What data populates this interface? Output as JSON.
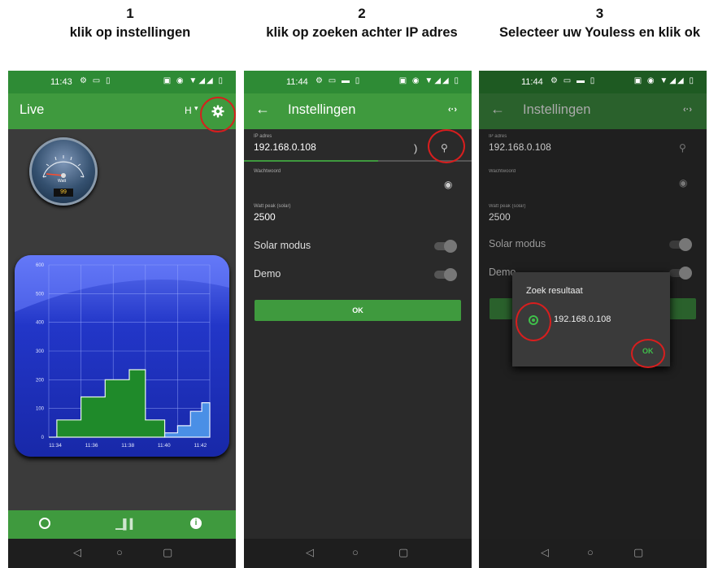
{
  "steps": [
    {
      "number": "1",
      "text": "klik op instellingen"
    },
    {
      "number": "2",
      "text": "klik op zoeken achter IP adres"
    },
    {
      "number": "3",
      "text": "Selecteer uw Youless en klik ok"
    }
  ],
  "phone1": {
    "time": "11:43",
    "title": "Live",
    "period": "H",
    "gauge": {
      "unit": "Watt",
      "value": "99",
      "scale": [
        "0",
        "500",
        "1000",
        "1500",
        "2000",
        "2500",
        "3000"
      ]
    },
    "nav_icons": [
      "gauge-icon",
      "bar-chart-icon",
      "info-icon"
    ]
  },
  "phone2": {
    "time": "11:44",
    "title": "Instellingen",
    "ip_label": "IP adres",
    "ip_value": "192.168.0.108",
    "password_label": "Wachtwoord",
    "watt_label": "Watt peak (solar)",
    "watt_value": "2500",
    "solar_label": "Solar modus",
    "demo_label": "Demo",
    "ok_label": "OK"
  },
  "phone3": {
    "time": "11:44",
    "title": "Instellingen",
    "ip_label": "IP adres",
    "ip_value": "192.168.0.108",
    "password_label": "Wachtwoord",
    "watt_label": "Watt peak (solar)",
    "watt_value": "2500",
    "solar_label": "Solar modus",
    "demo_label": "Demo",
    "dialog_title": "Zoek resultaat",
    "dialog_option": "192.168.0.108",
    "dialog_ok": "OK"
  },
  "colors": {
    "green": "#3f9a3e",
    "green_dark": "#2f7d31",
    "chart_blue": "#1a2fb8"
  },
  "chart_data": {
    "type": "area",
    "x": [
      "11:34",
      "11:36",
      "11:38",
      "11:40",
      "11:42"
    ],
    "y_ticks": [
      "0",
      "100",
      "200",
      "300",
      "400",
      "500",
      "600"
    ],
    "ylim": [
      0,
      600
    ],
    "green_steps": [
      [
        0,
        0
      ],
      [
        0.05,
        60
      ],
      [
        0.2,
        140
      ],
      [
        0.35,
        200
      ],
      [
        0.5,
        235
      ],
      [
        0.6,
        60
      ],
      [
        0.72,
        60
      ]
    ],
    "blue_steps": [
      [
        0.72,
        15
      ],
      [
        0.8,
        40
      ],
      [
        0.88,
        90
      ],
      [
        0.95,
        120
      ],
      [
        1,
        100
      ]
    ]
  }
}
